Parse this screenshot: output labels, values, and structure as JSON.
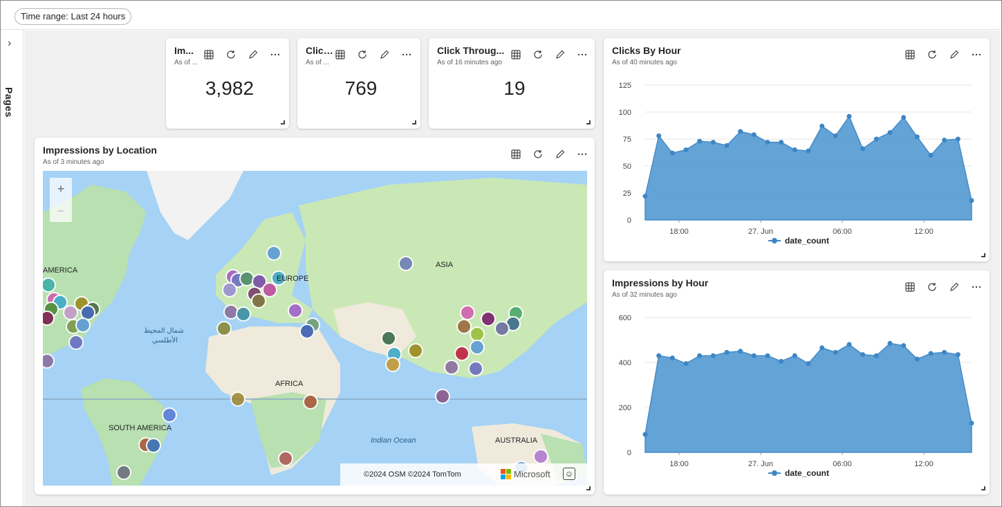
{
  "toolbar": {
    "time_range_label": "Time range: Last 24 hours"
  },
  "sidebar": {
    "pages_label": "Pages"
  },
  "tiles": {
    "impressions": {
      "title": "Im...",
      "subtitle": "As of ...",
      "value": "3,982"
    },
    "clicks": {
      "title": "Clicks",
      "subtitle": "As of ...",
      "value": "769"
    },
    "ctr": {
      "title": "Click Throug...",
      "subtitle": "As of 16 minutes ago",
      "value": "19"
    }
  },
  "map": {
    "title": "Impressions by Location",
    "subtitle": "As of 3 minutes ago",
    "labels": {
      "america": "AMERICA",
      "europe": "EUROPE",
      "asia": "ASIA",
      "africa": "AFRICA",
      "south_america": "SOUTH AMERICA",
      "australia": "AUSTRALIA",
      "indian_ocean": "Indian Ocean",
      "atlantic_ar_1": "شمال المحيط",
      "atlantic_ar_2": "الأطلسي"
    },
    "attribution": "©2024 OSM  ©2024 TomTom",
    "brand": "Microsoft",
    "zoom_in": "+",
    "zoom_out": "−"
  },
  "charts_meta": {
    "clicks": {
      "title": "Clicks By Hour",
      "subtitle": "As of 40 minutes ago"
    },
    "impressions": {
      "title": "Impressions by Hour",
      "subtitle": "As of 32 minutes ago"
    }
  },
  "chart_data": [
    {
      "type": "area",
      "title": "Clicks By Hour",
      "x_tick_labels": [
        "18:00",
        "27. Jun",
        "06:00",
        "12:00"
      ],
      "yticks": [
        0,
        25,
        50,
        75,
        100,
        125
      ],
      "ylim": [
        0,
        125
      ],
      "grid": true,
      "legend": "bottom",
      "series": [
        {
          "name": "date_count",
          "values": [
            22,
            78,
            62,
            65,
            73,
            72,
            69,
            82,
            79,
            72,
            72,
            65,
            64,
            87,
            78,
            96,
            66,
            75,
            81,
            95,
            77,
            60,
            74,
            75,
            18
          ]
        }
      ]
    },
    {
      "type": "area",
      "title": "Impressions by Hour",
      "x_tick_labels": [
        "18:00",
        "27. Jun",
        "06:00",
        "12:00"
      ],
      "yticks": [
        0,
        200,
        400,
        600
      ],
      "ylim": [
        0,
        600
      ],
      "grid": true,
      "legend": "bottom",
      "series": [
        {
          "name": "date_count",
          "values": [
            80,
            430,
            420,
            395,
            430,
            430,
            445,
            450,
            430,
            430,
            405,
            430,
            395,
            465,
            445,
            480,
            435,
            430,
            485,
            475,
            415,
            440,
            445,
            435,
            130
          ]
        }
      ]
    }
  ],
  "colors": {
    "accent": "#3d86c6",
    "area_fill": "#5c9fd4"
  }
}
